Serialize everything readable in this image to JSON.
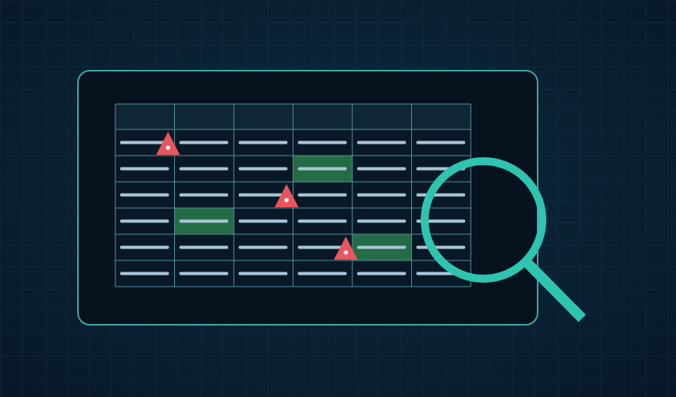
{
  "spreadsheet": {
    "columns": 6,
    "rows": 6,
    "highlighted_cells": [
      {
        "row": 1,
        "col": 3
      },
      {
        "row": 3,
        "col": 1
      },
      {
        "row": 4,
        "col": 4
      }
    ],
    "warnings": [
      {
        "row": 0,
        "col": 0
      },
      {
        "row": 2,
        "col": 2
      },
      {
        "row": 4,
        "col": 3
      }
    ]
  },
  "colors": {
    "accent": "#2ec4b0",
    "panel_border": "#3aa89c",
    "grid_line": "#4f8f98",
    "header_fill": "#0f2634",
    "highlight": "#236c46",
    "text_line": "#a9c6d4",
    "warning": "#e8555e"
  },
  "icons": {
    "magnifier": "magnifier-icon",
    "warning": "warning-triangle-icon"
  }
}
